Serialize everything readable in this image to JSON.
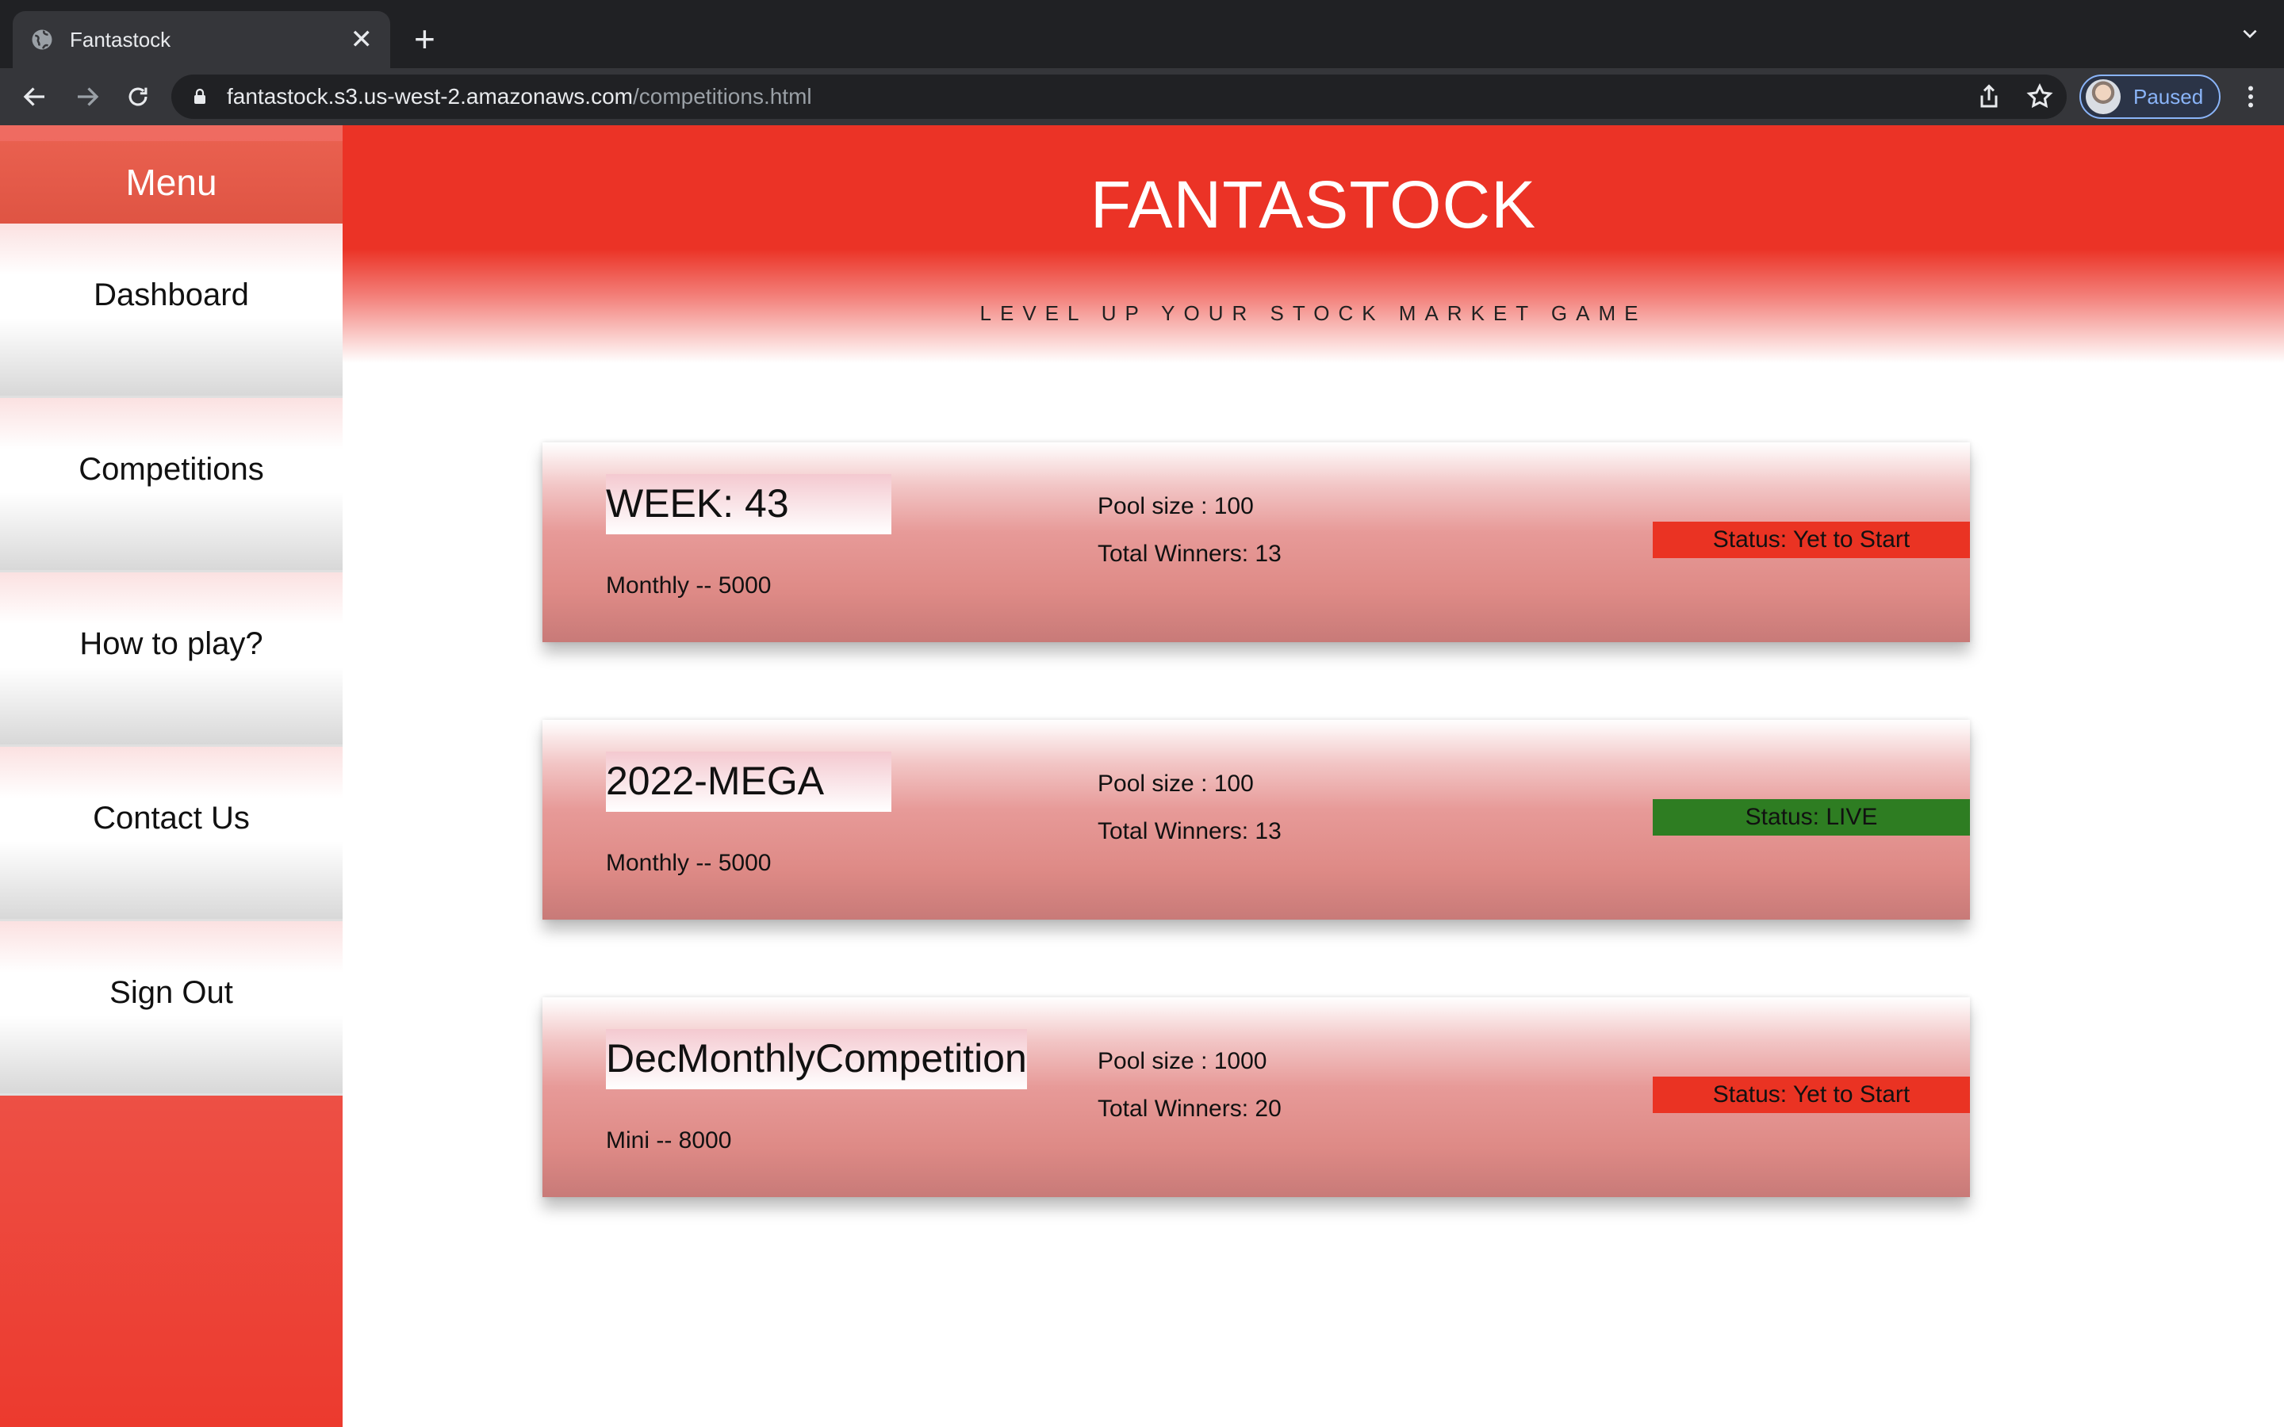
{
  "browser": {
    "tab_title": "Fantastock",
    "url_host": "fantastock.s3.us-west-2.amazonaws.com",
    "url_path": "/competitions.html",
    "profile_label": "Paused"
  },
  "sidebar": {
    "menu_title": "Menu",
    "items": [
      {
        "label": "Dashboard"
      },
      {
        "label": "Competitions"
      },
      {
        "label": "How to play?"
      },
      {
        "label": "Contact Us"
      },
      {
        "label": "Sign Out"
      }
    ]
  },
  "header": {
    "brand": "FANTASTOCK",
    "tagline": "LEVEL UP YOUR STOCK MARKET GAME"
  },
  "competitions": [
    {
      "name": "WEEK: 43",
      "type_line": "Monthly -- 5000",
      "pool": "Pool size : 100",
      "winners": "Total Winners: 13",
      "status": "Status: Yet to Start",
      "status_color": "#ea3323"
    },
    {
      "name": "2022-MEGA",
      "type_line": "Monthly -- 5000",
      "pool": "Pool size : 100",
      "winners": "Total Winners: 13",
      "status": "Status: LIVE",
      "status_color": "#2e7d22"
    },
    {
      "name": "DecMonthlyCompetition",
      "type_line": "Mini -- 8000",
      "pool": "Pool size : 1000",
      "winners": "Total Winners: 20",
      "status": "Status: Yet to Start",
      "status_color": "#ea3323"
    }
  ],
  "colors": {
    "brand_red": "#eb3326",
    "live_green": "#2e7d22"
  }
}
